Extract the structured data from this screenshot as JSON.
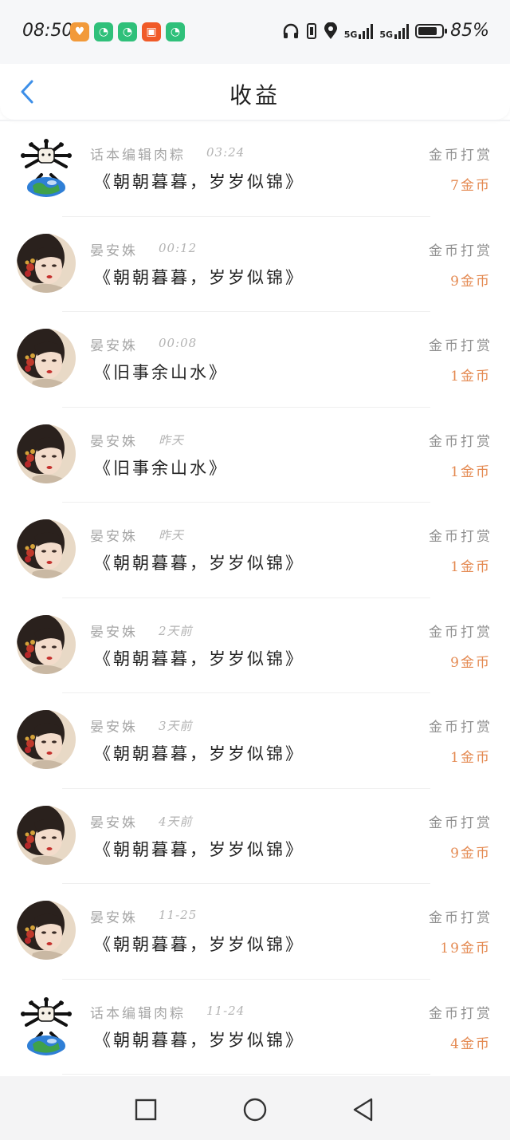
{
  "status_bar": {
    "time": "08:50",
    "network_1": "5G",
    "network_2": "5G",
    "battery_text": "85%",
    "battery_level": 0.85,
    "icons": [
      "heart-app-icon",
      "chat-app-icon",
      "chat-app-icon",
      "video-app-icon",
      "chat-app-icon",
      "headphones-icon",
      "vibrate-icon",
      "location-icon",
      "signal-icon",
      "signal-icon",
      "battery-icon"
    ]
  },
  "header": {
    "title": "收益",
    "back_icon": "chevron-left-icon"
  },
  "items": [
    {
      "avatar": "cartoon-avatar",
      "name": "话本编辑肉粽",
      "time": "03:24",
      "title": "《朝朝暮暮，岁岁似锦》",
      "type": "金币打赏",
      "amount": "7金币"
    },
    {
      "avatar": "portrait-avatar",
      "name": "晏安姝",
      "time": "00:12",
      "title": "《朝朝暮暮，岁岁似锦》",
      "type": "金币打赏",
      "amount": "9金币"
    },
    {
      "avatar": "portrait-avatar",
      "name": "晏安姝",
      "time": "00:08",
      "title": "《旧事余山水》",
      "type": "金币打赏",
      "amount": "1金币"
    },
    {
      "avatar": "portrait-avatar",
      "name": "晏安姝",
      "time": "昨天",
      "title": "《旧事余山水》",
      "type": "金币打赏",
      "amount": "1金币"
    },
    {
      "avatar": "portrait-avatar",
      "name": "晏安姝",
      "time": "昨天",
      "title": "《朝朝暮暮，岁岁似锦》",
      "type": "金币打赏",
      "amount": "1金币"
    },
    {
      "avatar": "portrait-avatar",
      "name": "晏安姝",
      "time": "2天前",
      "title": "《朝朝暮暮，岁岁似锦》",
      "type": "金币打赏",
      "amount": "9金币"
    },
    {
      "avatar": "portrait-avatar",
      "name": "晏安姝",
      "time": "3天前",
      "title": "《朝朝暮暮，岁岁似锦》",
      "type": "金币打赏",
      "amount": "1金币"
    },
    {
      "avatar": "portrait-avatar",
      "name": "晏安姝",
      "time": "4天前",
      "title": "《朝朝暮暮，岁岁似锦》",
      "type": "金币打赏",
      "amount": "9金币"
    },
    {
      "avatar": "portrait-avatar",
      "name": "晏安姝",
      "time": "11-25",
      "title": "《朝朝暮暮，岁岁似锦》",
      "type": "金币打赏",
      "amount": "19金币"
    },
    {
      "avatar": "cartoon-avatar",
      "name": "话本编辑肉粽",
      "time": "11-24",
      "title": "《朝朝暮暮，岁岁似锦》",
      "type": "金币打赏",
      "amount": "4金币"
    }
  ],
  "nav_bar": {
    "buttons": [
      "recent-apps-icon",
      "home-icon",
      "back-icon"
    ]
  },
  "colors": {
    "amount": "#e48a52",
    "back_chevron": "#3d8fe8",
    "name_gray": "#a6a6a6"
  }
}
